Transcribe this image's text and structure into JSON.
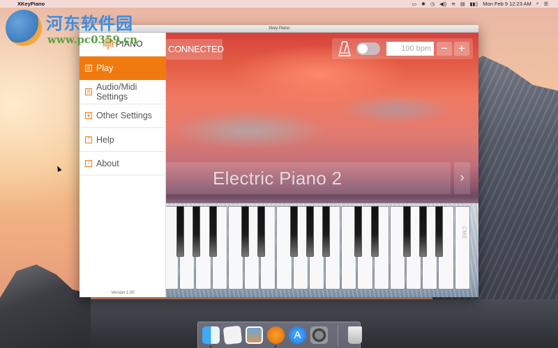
{
  "menubar": {
    "apple_icon": "apple-icon",
    "app_name": "XKeyPiano",
    "status_icons": [
      "airplay-icon",
      "bluetooth-icon",
      "time-machine-icon",
      "volume-icon",
      "wifi-icon",
      "keyboard-input-icon",
      "battery-icon"
    ],
    "clock": "Mon Feb 9  12:23 AM",
    "search_icon": "spotlight-search-icon",
    "notification_icon": "notification-center-icon"
  },
  "watermark": {
    "title": "河东软件园",
    "url": "www.pc0359.cn"
  },
  "window": {
    "title": "Xkey Piano"
  },
  "sidebar": {
    "brand": "PIANO",
    "items": [
      {
        "label": "Play",
        "icon": "piano-keys-icon",
        "glyph": "|||",
        "active": true
      },
      {
        "label": "Audio/Midi Settings",
        "icon": "midi-icon",
        "glyph": "|||",
        "active": false
      },
      {
        "label": "Other Settings",
        "icon": "settings-icon",
        "glyph": "●",
        "active": false
      },
      {
        "label": "Help",
        "icon": "help-icon",
        "glyph": "?",
        "active": false
      },
      {
        "label": "About",
        "icon": "info-icon",
        "glyph": "i",
        "active": false
      }
    ],
    "version": "Version 1.00"
  },
  "toolbar": {
    "connection_status": "CONNECTED",
    "metronome_enabled": false,
    "tempo_value": "100 bpm",
    "decrement_label": "−",
    "increment_label": "+"
  },
  "instrument": {
    "patch_name": "Electric Piano 2",
    "next_label": "›"
  },
  "keyboard": {
    "white_key_count": 19,
    "black_key_pattern": [
      1,
      1,
      1,
      0,
      1,
      1,
      0,
      1,
      1,
      1,
      0,
      1,
      1,
      0,
      1,
      1,
      1,
      0
    ],
    "brand_label": "CME"
  },
  "dock": {
    "items": [
      {
        "name": "finder",
        "running": true
      },
      {
        "name": "notes",
        "running": false
      },
      {
        "name": "preview",
        "running": false
      },
      {
        "name": "xkey-piano",
        "running": true
      },
      {
        "name": "app-store",
        "running": false
      },
      {
        "name": "system-preferences",
        "running": false
      },
      {
        "name": "trash",
        "running": false
      }
    ]
  },
  "colors": {
    "accent": "#f07a10",
    "sidebar_bg": "#ffffff"
  }
}
